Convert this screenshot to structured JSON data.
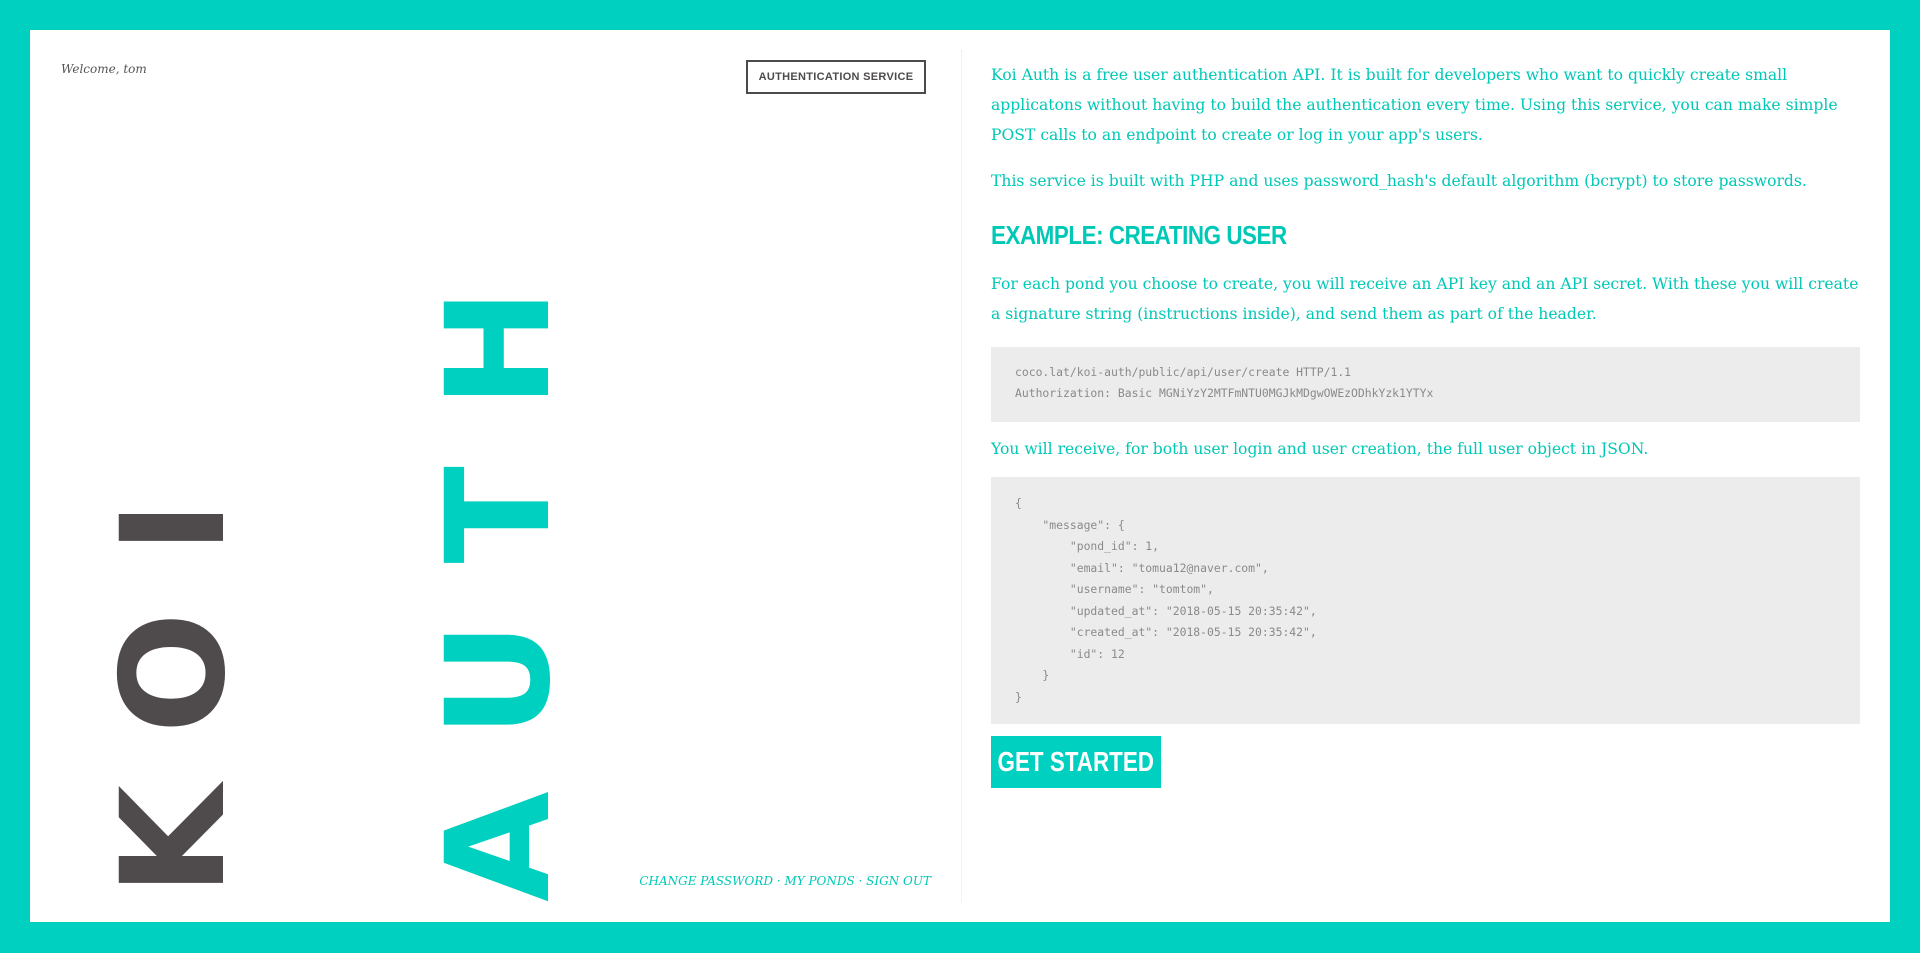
{
  "header": {
    "welcome": "Welcome, tom",
    "auth_service_label": "AUTHENTICATION SERVICE"
  },
  "hero": {
    "word1": "KOI",
    "word2": "AUTH"
  },
  "footer": {
    "links": [
      "CHANGE PASSWORD",
      "MY PONDS",
      "SIGN OUT"
    ],
    "separator": " · "
  },
  "content": {
    "intro": "Koi Auth is a free user authentication API. It is built for developers who want to quickly create small applicatons without having to build the authentication every time. Using this service, you can make simple POST calls to an endpoint to create or log in your app's users.",
    "php_note": "This service is built with PHP and uses password_hash's default algorithm (bcrypt) to store passwords.",
    "example_title": "EXAMPLE: CREATING USER",
    "each_pond": "For each pond you choose to create, you will receive an API key and an API secret. With these you will create a signature string (instructions inside), and send them as part of the header.",
    "request_code": "coco.lat/koi-auth/public/api/user/create HTTP/1.1\nAuthorization: Basic MGNiYzY2MTFmNTU0MGJkMDgwOWEzODhkYzk1YTYx",
    "receive_note": "You will receive, for both user login and user creation, the full user object in JSON.",
    "response_code": "{\n    \"message\": {\n        \"pond_id\": 1,\n        \"email\": \"tomua12@naver.com\",\n        \"username\": \"tomtom\",\n        \"updated_at\": \"2018-05-15 20:35:42\",\n        \"created_at\": \"2018-05-15 20:35:42\",\n        \"id\": 12\n    }\n}",
    "get_started_label": "GET STARTED"
  },
  "colors": {
    "accent": "#00d0bf",
    "dark": "#4f4a4b",
    "code_bg": "#ececec"
  }
}
